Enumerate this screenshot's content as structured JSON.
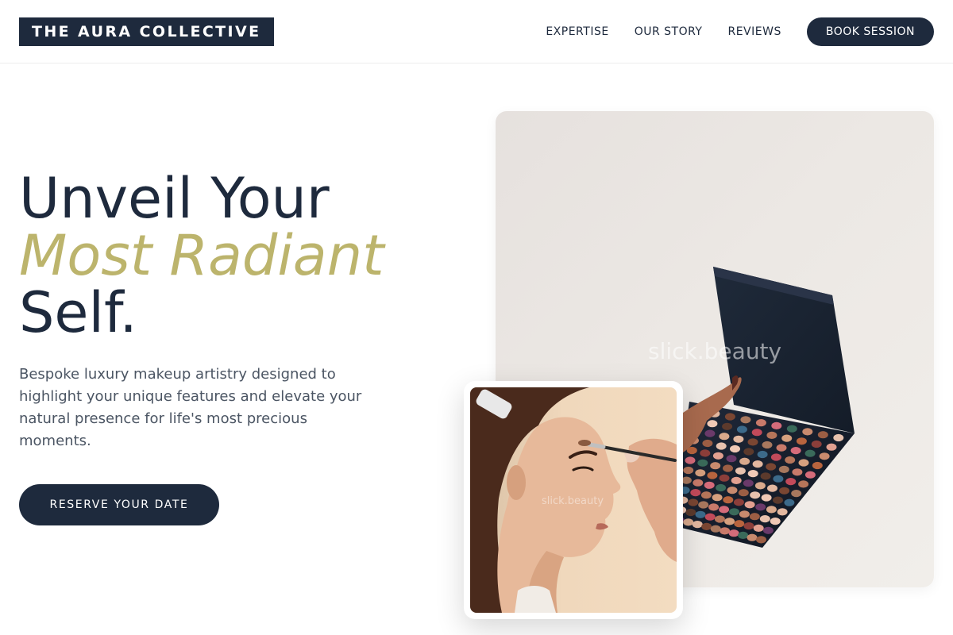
{
  "header": {
    "logo": "THE AURA COLLECTIVE",
    "nav": [
      {
        "label": "EXPERTISE"
      },
      {
        "label": "OUR STORY"
      },
      {
        "label": "REVIEWS"
      }
    ],
    "cta": "BOOK SESSION"
  },
  "hero": {
    "title_line1": "Unveil Your",
    "title_accent": "Most Radiant",
    "title_line3": "Self.",
    "description": "Bespoke luxury makeup artistry designed to highlight your unique features and elevate your natural presence for life's most precious moments.",
    "cta": "RESERVE YOUR DATE"
  },
  "images": {
    "main_watermark": "slick.beauty",
    "secondary_watermark": "slick.beauty"
  },
  "colors": {
    "navy": "#1e2a3d",
    "accent_gold": "#bcb46c",
    "body_text": "#4b5563"
  }
}
